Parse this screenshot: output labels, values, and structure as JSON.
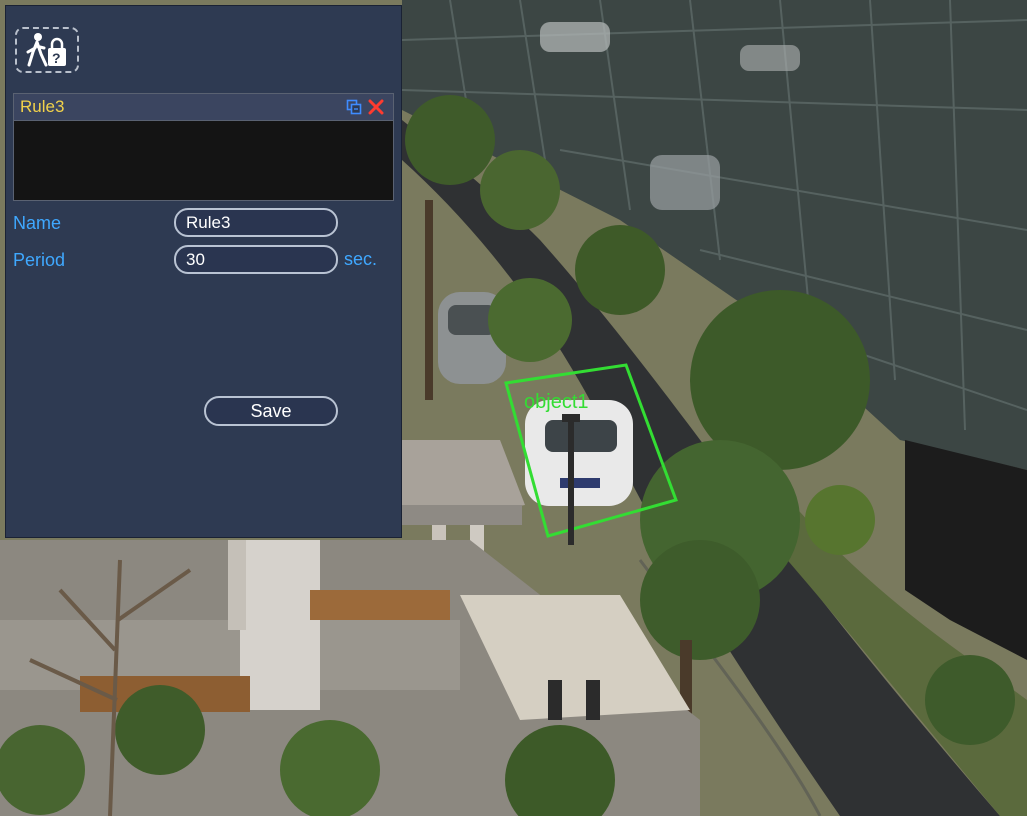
{
  "panel": {
    "rule_tool_icon": "pedestrian-lock-help-icon",
    "rules": [
      {
        "name": "Rule3",
        "selected": true,
        "edit_icon": "copy-icon",
        "delete_icon": "close-icon"
      }
    ],
    "fields": {
      "name_label": "Name",
      "name_value": "Rule3",
      "period_label": "Period",
      "period_value": "30",
      "period_unit": "sec."
    },
    "save_label": "Save"
  },
  "overlay": {
    "object_label": "object1",
    "box_color": "#33dd33",
    "label_color": "#33dd33"
  },
  "colors": {
    "panel_bg": "#2e3a52",
    "label_blue": "#3fa8ff",
    "rule_yellow": "#f2d24a",
    "delete_red": "#ff3b2f"
  }
}
